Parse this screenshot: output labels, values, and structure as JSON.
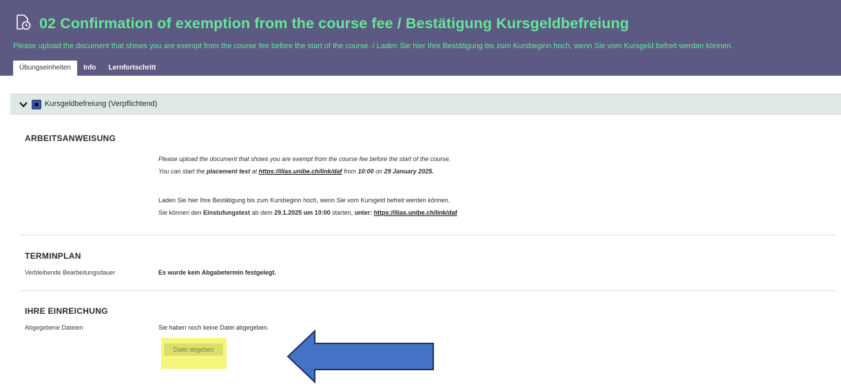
{
  "header": {
    "title": "02 Confirmation of exemption from the course fee / Bestätigung Kursgeldbefreiung",
    "subtitle": "Please upload the document that shows you are exempt from the course fee before the start of the course. / Laden Sie hier Ihre Bestätigung bis zum Kursbeginn hoch, wenn Sie vom Kursgeld befreit werden können.",
    "icon": "exercise-clock-icon",
    "tabs": [
      {
        "label": "Übungseinheiten",
        "active": true
      },
      {
        "label": "Info",
        "active": false
      },
      {
        "label": "Lernfortschritt",
        "active": false
      }
    ]
  },
  "section": {
    "label": "Kursgeldbefreiung (Verpflichtend)",
    "icons": [
      "chevron-down-icon",
      "status-icon"
    ]
  },
  "instructions": {
    "heading": "ARBEITSANWEISUNG",
    "en_line1": "Please upload the document that shows you are exempt from the course fee before the start of the course.",
    "en_line2_a": "You can start the ",
    "en_line2_b": "placement test",
    "en_line2_c": " at ",
    "en_line2_link": "https://ilias.unibe.ch/link/daf",
    "en_line2_d": " from ",
    "en_line2_e": "10:00",
    "en_line2_f": " on ",
    "en_line2_g": "29 January 2025.",
    "de_line1": "Laden Sie hier Ihre Bestätigung bis zum Kursbeginn hoch, wenn Sie vom Kursgeld befreit werden können.",
    "de_line2_a": "Sie können den ",
    "de_line2_b": "Einstufungstest",
    "de_line2_c": " ab dem ",
    "de_line2_d": "29.1.2025 um 10:00",
    "de_line2_e": " starten, ",
    "de_line2_f": "unter: ",
    "de_line2_link": "https://ilias.unibe.ch/link/daf"
  },
  "schedule": {
    "heading": "TERMINPLAN",
    "label": "Verbleibende Bearbeitungsdauer",
    "value": "Es wurde kein Abgabetermin festgelegt."
  },
  "submission": {
    "heading": "IHRE EINREICHUNG",
    "label": "Abgegebene Dateien",
    "value": "Sie haben noch keine Datei abgegeben.",
    "button_label": "Datei abgeben"
  },
  "colors": {
    "header_bg": "#5c5a82",
    "title_green": "#66e69a",
    "section_bg": "#dfe9e3",
    "highlight": "#f6f77a",
    "arrow_blue": "#4472c4"
  }
}
